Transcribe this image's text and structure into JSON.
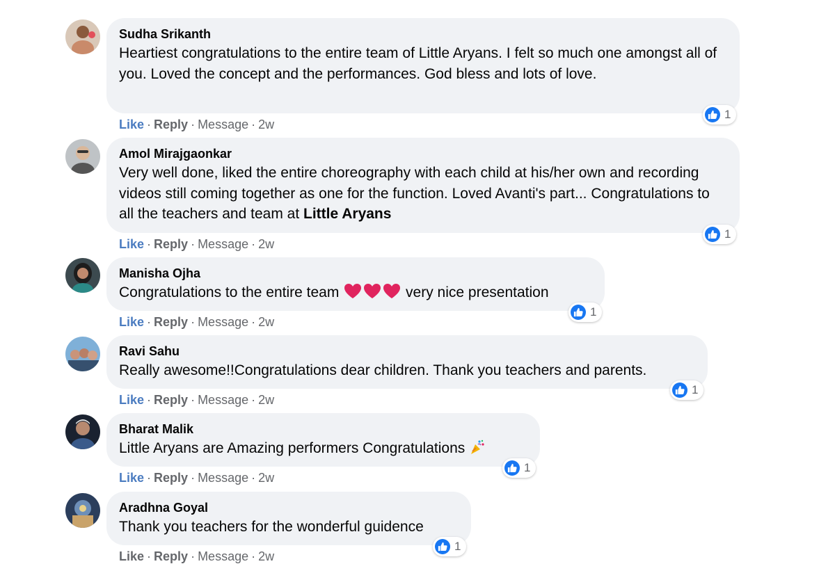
{
  "colors": {
    "bubble_bg": "#f0f2f5",
    "like_blue": "#1877f2",
    "secondary_text": "#65676b"
  },
  "comments": [
    {
      "author": "Sudha Srikanth",
      "text": "Heartiest congratulations to the entire team of Little Aryans. I felt so much one amongst all of you. Loved the concept and the performances. God bless and lots of love.",
      "reaction_icon": "like-icon",
      "reaction_count": "1",
      "actions": {
        "like": "Like",
        "reply": "Reply",
        "message": "Message",
        "time": "2w",
        "sep": "·"
      }
    },
    {
      "author": "Amol Mirajgaonkar",
      "text": "Very well done, liked the entire choreography with each child at his/her own and recording videos still coming together as one for the function. Loved Avanti's part... Congratulations to all the teachers and team at",
      "text_tag": "Little Aryans",
      "reaction_icon": "like-icon",
      "reaction_count": "1",
      "actions": {
        "like": "Like",
        "reply": "Reply",
        "message": "Message",
        "time": "2w",
        "sep": "·"
      }
    },
    {
      "author": "Manisha Ojha",
      "text_before": "Congratulations to the entire team",
      "text_emoji": "heart-icons",
      "text_after": "very nice presentation",
      "reaction_icon": "like-icon",
      "reaction_count": "1",
      "actions": {
        "like": "Like",
        "reply": "Reply",
        "message": "Message",
        "time": "2w",
        "sep": "·"
      }
    },
    {
      "author": "Ravi Sahu",
      "text": "Really awesome!!Congratulations dear children. Thank you teachers and parents.",
      "reaction_icon": "like-icon",
      "reaction_count": "1",
      "actions": {
        "like": "Like",
        "reply": "Reply",
        "message": "Message",
        "time": "2w",
        "sep": "·"
      }
    },
    {
      "author": "Bharat Malik",
      "text": "Little Aryans are Amazing performers Congratulations",
      "text_emoji": "party-popper-icon",
      "reaction_icon": "like-icon",
      "reaction_count": "1",
      "actions": {
        "like": "Like",
        "reply": "Reply",
        "message": "Message",
        "time": "2w",
        "sep": "·"
      }
    },
    {
      "author": "Aradhna Goyal",
      "text": "Thank you teachers for the wonderful guidence",
      "reaction_icon": "like-icon",
      "reaction_count": "1",
      "actions": {
        "like": "Like",
        "reply": "Reply",
        "message": "Message",
        "time": "2w",
        "sep": "·"
      }
    }
  ]
}
